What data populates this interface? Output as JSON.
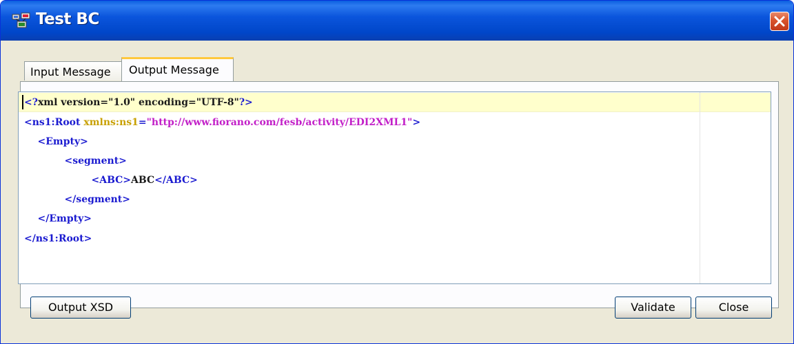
{
  "window": {
    "title": "Test BC"
  },
  "tabs": [
    {
      "label": "Input Message",
      "selected": false
    },
    {
      "label": "Output Message",
      "selected": true
    }
  ],
  "editor": {
    "lines": [
      [
        {
          "t": "<?",
          "c": "tag"
        },
        {
          "t": "xml version=\"1.0\" encoding=\"UTF-8\"",
          "c": "plain"
        },
        {
          "t": "?>",
          "c": "tag"
        }
      ],
      [
        {
          "t": "<ns1:Root ",
          "c": "tag"
        },
        {
          "t": "xmlns:ns1",
          "c": "attr"
        },
        {
          "t": "=",
          "c": "tag"
        },
        {
          "t": "\"http://www.fiorano.com/fesb/activity/EDI2XML1\"",
          "c": "str"
        },
        {
          "t": ">",
          "c": "tag"
        }
      ],
      [
        {
          "t": "    <Empty>",
          "c": "tag"
        }
      ],
      [
        {
          "t": "            <segment>",
          "c": "tag"
        }
      ],
      [
        {
          "t": "                    <ABC>",
          "c": "tag"
        },
        {
          "t": "ABC",
          "c": "plain"
        },
        {
          "t": "</ABC>",
          "c": "tag"
        }
      ],
      [
        {
          "t": "            </segment>",
          "c": "tag"
        }
      ],
      [
        {
          "t": "    </Empty>",
          "c": "tag"
        }
      ],
      [
        {
          "t": "</ns1:Root>",
          "c": "tag"
        }
      ]
    ]
  },
  "buttons": {
    "output_xsd": "Output XSD",
    "validate": "Validate",
    "close": "Close"
  },
  "colors": {
    "tag": "#1a1ad0",
    "attribute": "#c8a000",
    "string": "#c21fc8",
    "current_line": "#ffffcc"
  }
}
